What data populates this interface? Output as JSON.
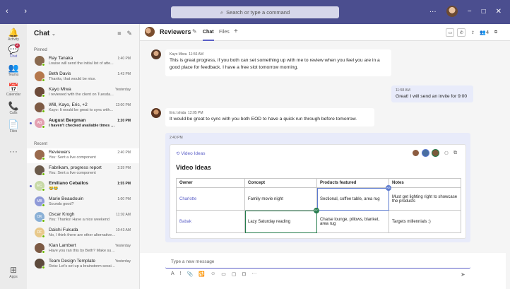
{
  "titlebar": {
    "back": "‹",
    "forward": "›",
    "search_placeholder": "Search or type a command",
    "more": "···",
    "minimize": "−",
    "maximize": "□",
    "close": "✕"
  },
  "rail": [
    {
      "label": "Activity",
      "icon": "🔔"
    },
    {
      "label": "Chat",
      "icon": "💬",
      "badge": "2"
    },
    {
      "label": "Teams",
      "icon": "👥"
    },
    {
      "label": "Calendar",
      "icon": "📅"
    },
    {
      "label": "Calls",
      "icon": "📞"
    },
    {
      "label": "Files",
      "icon": "📄"
    },
    {
      "label": "",
      "icon": "···"
    },
    {
      "label": "Apps",
      "icon": "⊞"
    }
  ],
  "chatlist": {
    "title": "Chat",
    "pinned_label": "Pinned",
    "recent_label": "Recent",
    "pinned": [
      {
        "name": "Ray Tanaka",
        "preview": "Louise will send the initial list of atte...",
        "time": "1:40 PM",
        "color": "#8a6a4f"
      },
      {
        "name": "Beth Davis",
        "preview": "Thanks, that would be nice.",
        "time": "1:43 PM",
        "color": "#b5784c"
      },
      {
        "name": "Kayo Miwa",
        "preview": "I reviewed with the client on Tuesda...",
        "time": "Yesterday",
        "color": "#6d4b3a"
      },
      {
        "name": "Will, Kayo, Eric, +2",
        "preview": "Kayo: It would be great to sync with...",
        "time": "12:00 PM",
        "color": "#7e5b45"
      },
      {
        "name": "August Bergman",
        "preview": "I haven't checked available times yet",
        "time": "1:20 PM",
        "initials": "AB",
        "color": "#e39fb0",
        "unread": true
      }
    ],
    "recent": [
      {
        "name": "Reviewers",
        "preview": "You: Sent a live component",
        "time": "2:40 PM",
        "color": "#9a6b4e",
        "selected": true
      },
      {
        "name": "Fabrikam, progress report",
        "preview": "You: Sent a live component",
        "time": "2:39 PM",
        "color": "#6b5a4a"
      },
      {
        "name": "Emiliano Ceballos",
        "preview": "😂😂",
        "time": "1:55 PM",
        "initials": "EC",
        "color": "#c7d9a7",
        "unread": true
      },
      {
        "name": "Marie Beaudouin",
        "preview": "Sounds good?",
        "time": "1:00 PM",
        "initials": "MB",
        "color": "#8f9ad8"
      },
      {
        "name": "Oscar Krogh",
        "preview": "You: Thanks! Have a nice weekend",
        "time": "11:02 AM",
        "initials": "OK",
        "color": "#8ab0d6"
      },
      {
        "name": "Daichi Fukuda",
        "preview": "No, I think there are other alternatives we c...",
        "time": "10:43 AM",
        "initials": "DF",
        "color": "#e8c98a"
      },
      {
        "name": "Kian Lambert",
        "preview": "Have you ran this by Beth? Make sure she is...",
        "time": "Yesterday",
        "color": "#7c5a44"
      },
      {
        "name": "Team Design Template",
        "preview": "Reta: Let's set up a brainstorm session for...",
        "time": "Yesterday",
        "color": "#5d4a3c"
      }
    ]
  },
  "header": {
    "title": "Reviewers",
    "tabs": [
      "Chat",
      "Files"
    ],
    "add": "+",
    "participants": "4"
  },
  "messages": [
    {
      "author": "Kayo Miwa",
      "time": "11:56 AM",
      "text": "This is great progress, if you both can set something up with me to review when you feel you are in a good place for feedback. I have a free slot tomorrow morning."
    },
    {
      "author": "",
      "time": "11:58 AM",
      "text": "Great! I will send an invite for 9:00",
      "mine": true
    },
    {
      "author": "Eric Ishida",
      "time": "12:05 PM",
      "text": "It would be great to sync with you both EOD to have a quick run through before tomorrow."
    }
  ],
  "card": {
    "time": "2:40 PM",
    "label": "Video Ideas",
    "title": "Video Ideas",
    "columns": [
      "Owner",
      "Concept",
      "Products featured",
      "Notes"
    ],
    "rows": [
      [
        "Charlotte",
        "Family movie night",
        "Sectional, coffee table, area rug",
        "Must get lighting right to showcase the products"
      ],
      [
        "Babak",
        "Lazy Saturday reading",
        "Chaise lounge, pillows, blanket, area rug",
        "Targets millennials :)"
      ]
    ],
    "tag_blue": "KB",
    "tag_green": "EC"
  },
  "compose": {
    "placeholder": "Type a new message",
    "tools": [
      "A",
      "!",
      "📎",
      "🔁",
      "☺",
      "▭",
      "▢",
      "⊡",
      "···"
    ],
    "send": "➤"
  },
  "colors": {
    "accent": "#5b5fc7",
    "titlebar": "#4b4e8f"
  }
}
